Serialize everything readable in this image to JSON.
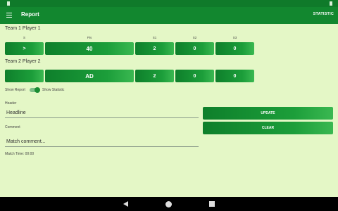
{
  "app": {
    "title": "Report",
    "statistic_label": "STATISTIC"
  },
  "team1": {
    "label": "Team 1 Player 1",
    "columns": [
      "S",
      "Pts",
      "S1",
      "S2",
      "S3"
    ],
    "serve": ">",
    "points": "40",
    "s1": "2",
    "s2": "0",
    "s3": "0"
  },
  "team2": {
    "label": "Team 2 Player 2",
    "serve": "",
    "points": "AD",
    "s1": "2",
    "s2": "0",
    "s3": "0"
  },
  "switches": {
    "show_report": "Show Report",
    "show_statistic": "Show Statistic"
  },
  "form": {
    "header_label": "Header",
    "headline_value": "Headline",
    "comment_label": "Comment",
    "comment_value": "Match comment...",
    "update_label": "UPDATE",
    "clear_label": "CLEAR",
    "match_time": "Match Time: 00:00"
  },
  "icons": {
    "menu": "menu-icon",
    "back": "back-icon",
    "home": "home-icon",
    "recents": "recents-icon"
  },
  "colors": {
    "primary": "#12872f",
    "background": "#e4f7c6"
  }
}
